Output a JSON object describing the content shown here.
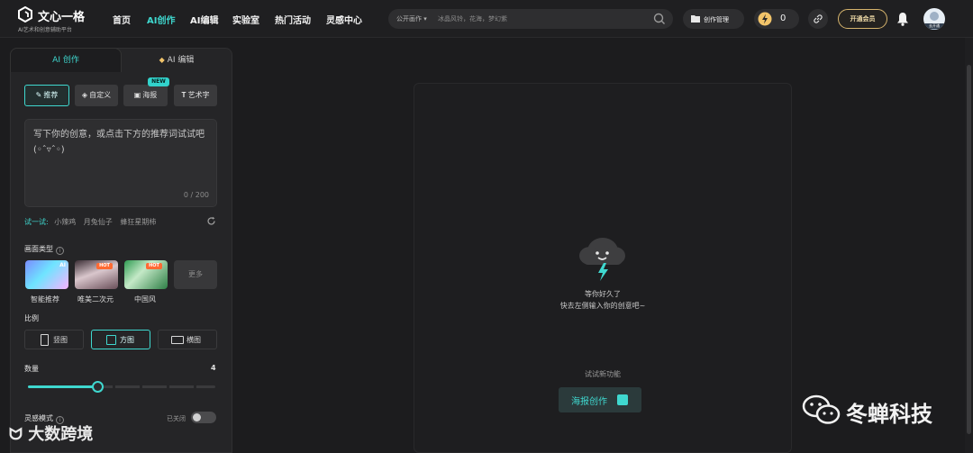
{
  "header": {
    "logo_name": "文心一格",
    "logo_tagline": "AI艺术和创意辅助平台",
    "nav": [
      "首页",
      "AI创作",
      "AI编辑",
      "实验室",
      "热门活动",
      "灵感中心"
    ],
    "active_nav": "AI创作",
    "search": {
      "scope": "公开画作 ▾",
      "placeholder": "冰晶风铃，花海，梦幻紫"
    },
    "manage_label": "创作管理",
    "credits": "0",
    "vip_label": "开通会员",
    "avatar_badge": "去开通"
  },
  "panel": {
    "tabs": [
      "AI 创作",
      "AI 编辑"
    ],
    "tab2_icon": "diamond-icon",
    "modes": [
      {
        "label": "推荐",
        "icon": "brush-icon",
        "active": true
      },
      {
        "label": "自定义",
        "icon": "cube-icon"
      },
      {
        "label": "海报",
        "icon": "image-icon",
        "badge": "NEW"
      },
      {
        "label": "艺术字",
        "icon": "text-icon"
      }
    ],
    "prompt_placeholder": "写下你的创意，或点击下方的推荐词试试吧(◦ˆ▿ˆ◦)",
    "prompt_count": "0 / 200",
    "try_label": "试一试:",
    "suggestions": [
      "小辣鸡",
      "月兔仙子",
      "蜂狂星期柿"
    ],
    "style_title": "画面类型",
    "styles": [
      {
        "label": "智能推荐",
        "tag": "AI"
      },
      {
        "label": "唯美二次元",
        "tag": "HOT"
      },
      {
        "label": "中国风",
        "tag": "HOT"
      }
    ],
    "more_label": "更多",
    "ratio_title": "比例",
    "ratios": [
      "竖图",
      "方图",
      "横图"
    ],
    "active_ratio": "方图",
    "quantity_label": "数量",
    "quantity_value": "4",
    "quantity_fraction": 0.375,
    "inspiration_label": "灵感模式",
    "inspiration_state": "已关闭"
  },
  "canvas": {
    "empty_line1": "等你好久了",
    "empty_line2": "快去左侧输入你的创意吧~",
    "try_new": "试试新功能",
    "poster_button": "海报创作"
  },
  "watermarks": {
    "left": "大数跨境",
    "right": "冬蝉科技"
  },
  "colors": {
    "accent": "#3fd8cf",
    "background": "#1c1c1e",
    "vip_gold": "#d6b46d",
    "hot": "#ff6a33"
  }
}
